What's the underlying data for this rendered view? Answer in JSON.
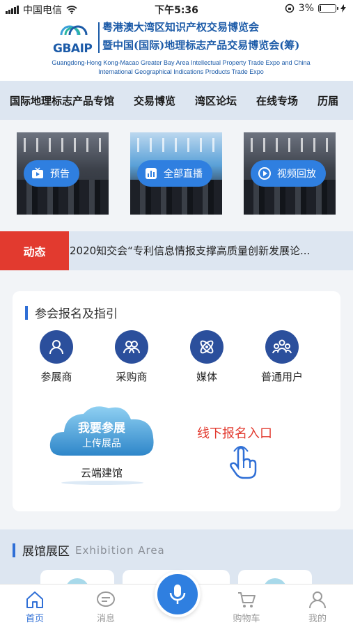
{
  "status_bar": {
    "carrier": "中国电信",
    "time": "下午5:36",
    "battery": "3%"
  },
  "header": {
    "logo_text": "GBAIP",
    "title_cn_1": "粤港澳大湾区知识产权交易博览会",
    "title_cn_2": "暨中国(国际)地理标志产品交易博览会(筹)",
    "title_en": "Guangdong-Hong Kong-Macao Greater Bay Area Intellectual Property Trade Expo and China International Geographical Indications Products Trade Expo"
  },
  "nav": {
    "tabs": [
      "国际地理标志产品专馆",
      "交易博览",
      "湾区论坛",
      "在线专场",
      "历届"
    ]
  },
  "video_cards": [
    {
      "label": "预告",
      "icon": "tv-icon"
    },
    {
      "label": "全部直播",
      "icon": "bar-chart-icon"
    },
    {
      "label": "视频回放",
      "icon": "replay-icon"
    }
  ],
  "news": {
    "tag": "动态",
    "text": "2020知交会“专利信息情报支撑高质量创新发展论..."
  },
  "registration": {
    "title": "参会报名及指引",
    "roles": [
      {
        "label": "参展商",
        "icon": "person-icon"
      },
      {
        "label": "采购商",
        "icon": "group-icon"
      },
      {
        "label": "媒体",
        "icon": "atom-icon"
      },
      {
        "label": "普通用户",
        "icon": "users-icon"
      }
    ],
    "cloud_title": "我要参展",
    "cloud_subtitle": "上传展品",
    "cloud_caption": "云端建馆",
    "offline_label": "线下报名入口"
  },
  "exhibition": {
    "title_cn": "展馆展区",
    "title_en": "Exhibition  Area"
  },
  "tab_bar": {
    "items": [
      {
        "label": "首页",
        "icon": "home-icon",
        "active": true
      },
      {
        "label": "消息",
        "icon": "message-icon",
        "active": false
      },
      {
        "label": "购物车",
        "icon": "cart-icon",
        "active": false
      },
      {
        "label": "我的",
        "icon": "profile-icon",
        "active": false
      }
    ],
    "center_icon": "microphone-icon"
  },
  "colors": {
    "primary": "#2f7fe0",
    "nav_bg": "#dde6f1",
    "alert": "#e23a2f",
    "brand": "#1c5ba8"
  }
}
